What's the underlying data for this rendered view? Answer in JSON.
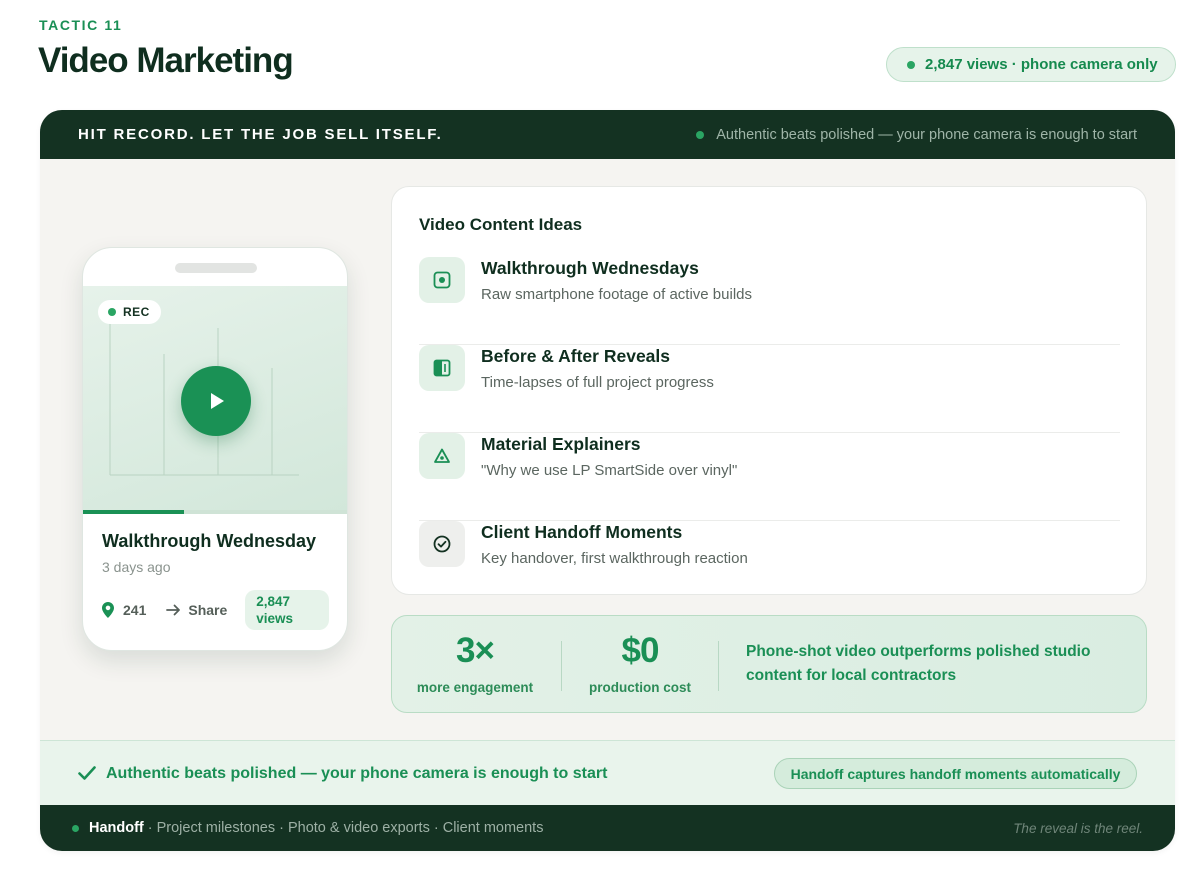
{
  "header": {
    "eyebrow": "TACTIC 11",
    "title": "Video Marketing",
    "pill": "2,847 views · phone camera only"
  },
  "card": {
    "title": "HIT RECORD. LET THE JOB SELL ITSELF.",
    "note": "Authentic beats polished — your phone camera is enough to start"
  },
  "phone": {
    "rec_label": "REC",
    "progress": 0.38,
    "video_title": "Walkthrough Wednesday",
    "date": "3 days ago",
    "pins": "241",
    "share_label": "Share",
    "views_count": "2,847",
    "views_label": "views"
  },
  "ideas": {
    "title": "Video Content Ideas",
    "items": [
      {
        "title": "Walkthrough Wednesdays",
        "desc": "Raw smartphone footage of active builds",
        "icon": "camera-record-icon"
      },
      {
        "title": "Before & After Reveals",
        "desc": "Time-lapses of full project progress",
        "icon": "split-compare-icon"
      },
      {
        "title": "Material Explainers",
        "desc": "\"Why we use LP SmartSide over vinyl\"",
        "icon": "triangle-icon"
      },
      {
        "title": "Client Handoff Moments",
        "desc": "Key handover, first walkthrough reaction",
        "icon": "check-circle-icon"
      }
    ]
  },
  "stats": {
    "engagement_value": "3×",
    "engagement_label": "more engagement",
    "cost_value": "$0",
    "cost_label": "production cost",
    "note": "Phone-shot video outperforms polished studio content for local contractors"
  },
  "callout": {
    "text": "Authentic beats polished — your phone camera is enough to start",
    "pill": "Handoff captures handoff moments automatically"
  },
  "footer": {
    "brand": "Handoff",
    "items": "· Project milestones · Photo & video exports · Client moments",
    "tagline": "The reveal is the reel."
  },
  "colors": {
    "dark_green": "#143222",
    "accent_green": "#1a9155",
    "light_green": "#e6f3ea"
  }
}
